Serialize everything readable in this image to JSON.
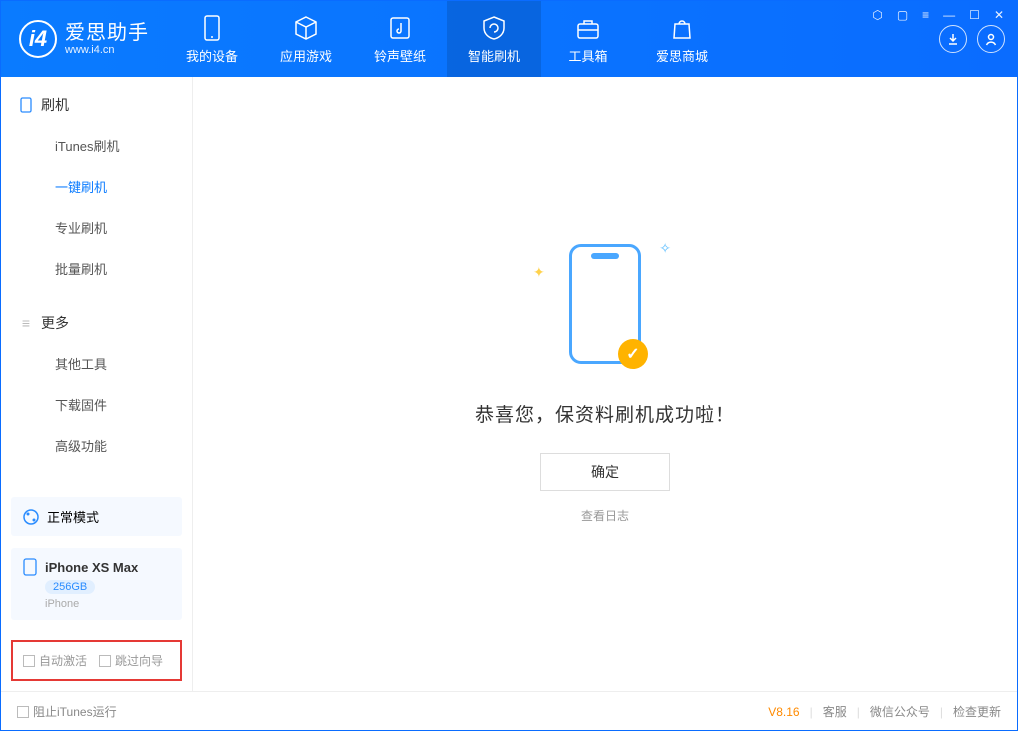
{
  "brand": {
    "cn": "爱思助手",
    "en": "www.i4.cn"
  },
  "tabs": {
    "device": "我的设备",
    "apps": "应用游戏",
    "ring": "铃声壁纸",
    "flash": "智能刷机",
    "tools": "工具箱",
    "store": "爱思商城"
  },
  "sidebar": {
    "sec1": "刷机",
    "items1": [
      "iTunes刷机",
      "一键刷机",
      "专业刷机",
      "批量刷机"
    ],
    "sec2": "更多",
    "items2": [
      "其他工具",
      "下载固件",
      "高级功能"
    ]
  },
  "mode": {
    "label": "正常模式"
  },
  "device": {
    "name": "iPhone XS Max",
    "capacity": "256GB",
    "type": "iPhone"
  },
  "checks": {
    "auto": "自动激活",
    "skip": "跳过向导"
  },
  "main": {
    "message": "恭喜您，保资料刷机成功啦！",
    "ok": "确定",
    "log": "查看日志"
  },
  "footer": {
    "block": "阻止iTunes运行",
    "version": "V8.16",
    "kf": "客服",
    "wx": "微信公众号",
    "upd": "检查更新"
  }
}
